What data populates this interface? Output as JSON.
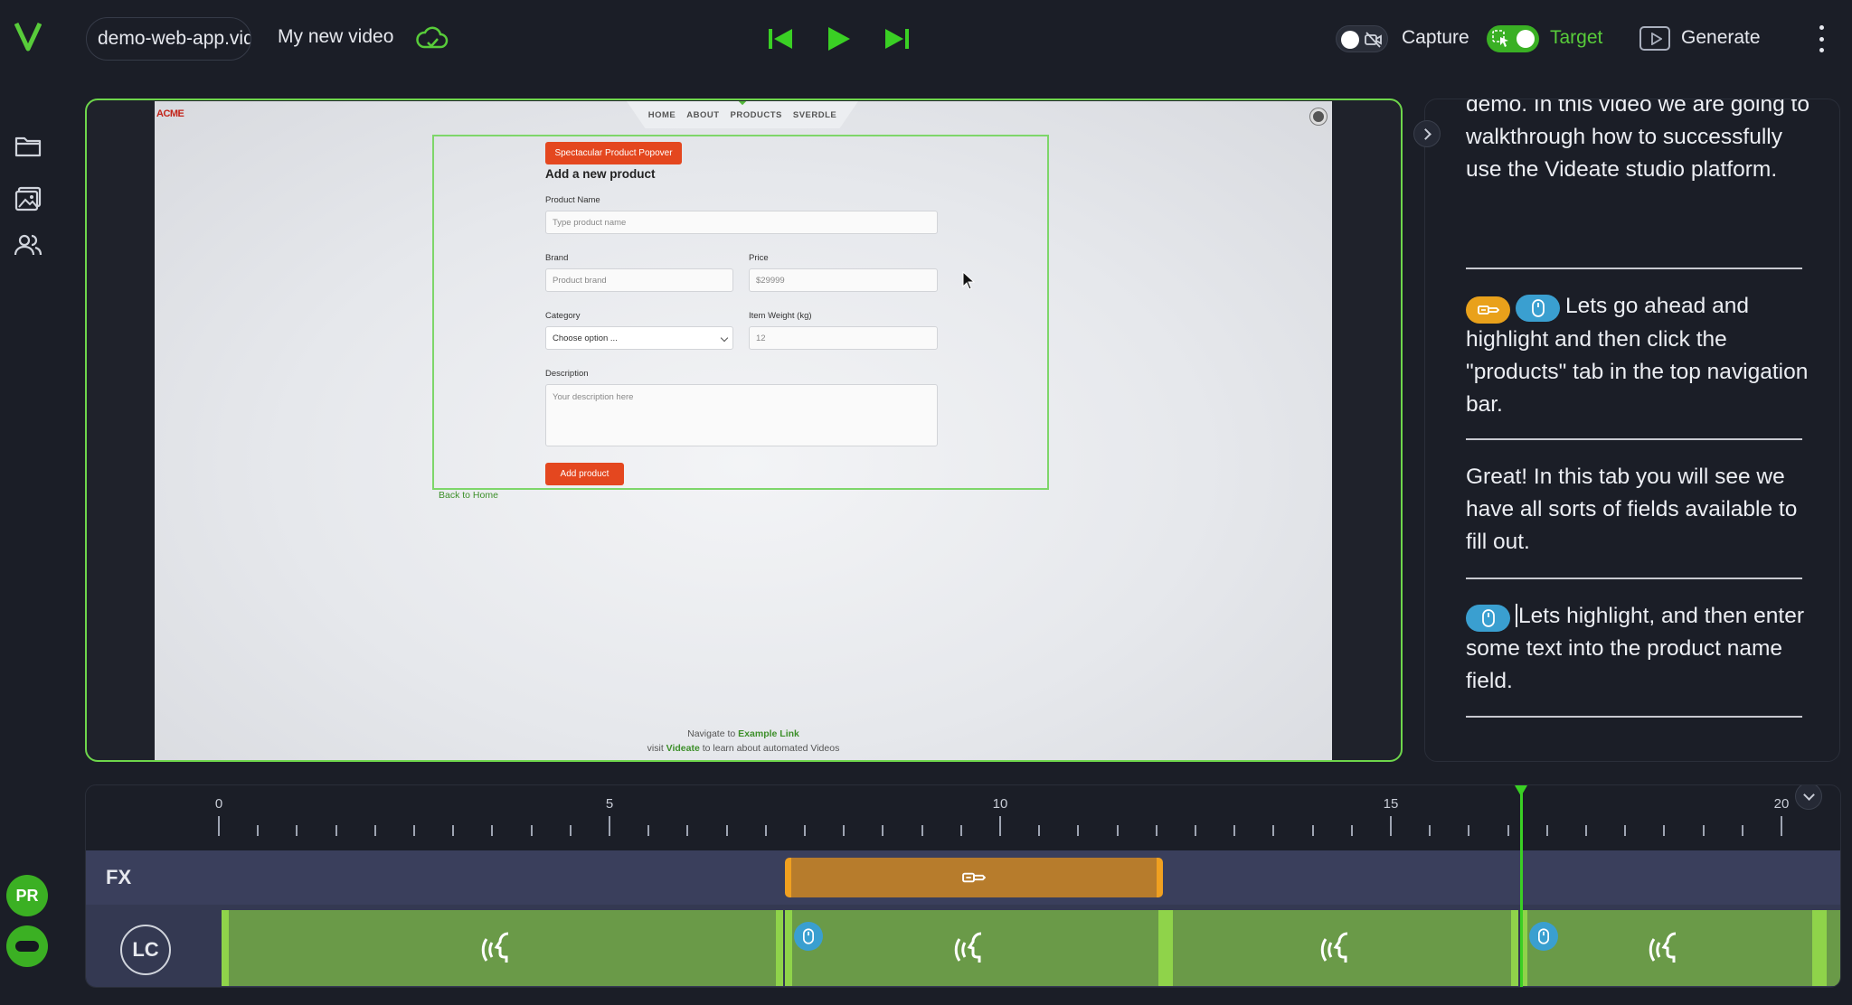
{
  "topbar": {
    "file_name": "demo-web-app.vid",
    "video_title": "My new video",
    "capture_label": "Capture",
    "target_label": "Target",
    "generate_label": "Generate"
  },
  "colors": {
    "accent_green": "#6ed64b",
    "bright_green": "#3ad024",
    "orange": "#e9a11b",
    "blue": "#3a9fd0",
    "site_button": "#e4471f"
  },
  "icons": [
    "logo-v",
    "cloud-check-icon",
    "skip-back-icon",
    "play-icon",
    "skip-forward-icon",
    "camera-off-icon",
    "cursor-target-icon",
    "play-square-icon",
    "kebab-icon",
    "folder-icon",
    "image-icon",
    "users-icon",
    "mouse-click-icon",
    "highlight-icon",
    "voice-icon"
  ],
  "sidebar": {
    "avatars": [
      {
        "initials": "PR"
      },
      {
        "initials": ""
      }
    ]
  },
  "preview": {
    "logo_text": "ACME",
    "nav": [
      "HOME",
      "ABOUT",
      "PRODUCTS",
      "SVERDLE"
    ],
    "popover_button": "Spectacular Product Popover",
    "form_title": "Add a new product",
    "fields": {
      "product_name": {
        "label": "Product Name",
        "placeholder": "Type product name"
      },
      "brand": {
        "label": "Brand",
        "placeholder": "Product brand"
      },
      "price": {
        "label": "Price",
        "placeholder": "$29999"
      },
      "category": {
        "label": "Category",
        "placeholder": "Choose option ..."
      },
      "weight": {
        "label": "Item Weight (kg)",
        "placeholder": "12"
      },
      "description": {
        "label": "Description",
        "placeholder": "Your description here"
      }
    },
    "add_button": "Add product",
    "back_link": "Back to Home",
    "footer1_prefix": "Navigate to ",
    "footer1_link": "Example Link",
    "footer2_prefix": "visit ",
    "footer2_link": "Videate",
    "footer2_suffix": " to learn about automated Videos"
  },
  "script": {
    "paragraphs": [
      {
        "text": "demo. In this video we are going to walkthrough how to successfully use the Videate studio platform."
      },
      {
        "text": "Lets go ahead and highlight and then click the \"products\" tab in the top navigation bar."
      },
      {
        "text": "Great! In this tab you will see we have all sorts of fields available to fill out."
      },
      {
        "text": "Lets highlight, and then enter some text into the product name field."
      }
    ]
  },
  "timeline": {
    "ruler": [
      "0",
      "5",
      "10",
      "15",
      "20"
    ],
    "tracks": {
      "fx": "FX",
      "voice_badge": "LC"
    }
  }
}
